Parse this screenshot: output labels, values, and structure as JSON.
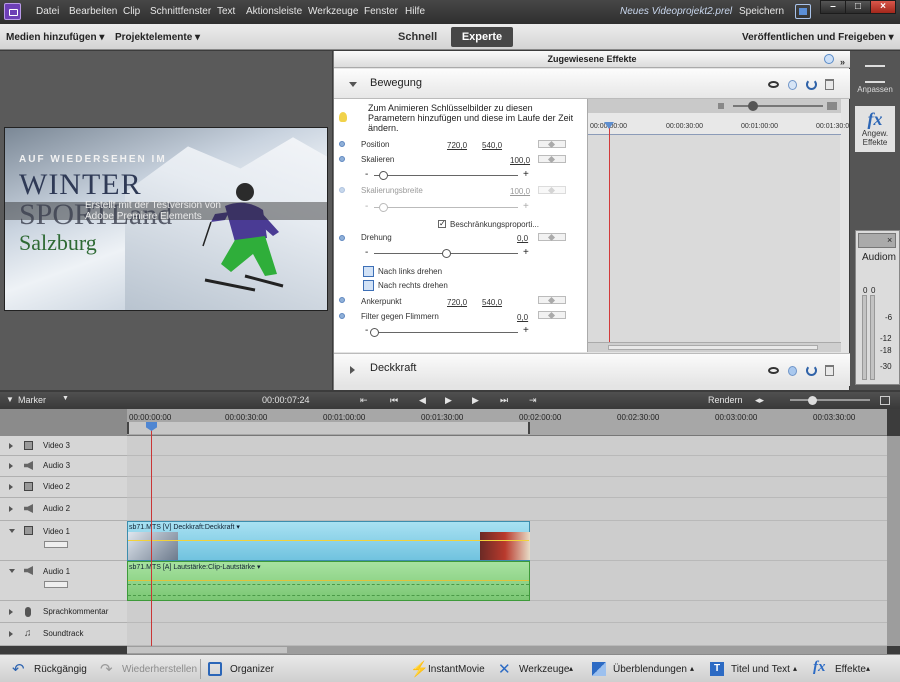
{
  "menubar": {
    "items": [
      "Datei",
      "Bearbeiten",
      "Clip",
      "Schnittfenster",
      "Text",
      "Aktionsleiste",
      "Werkzeuge",
      "Fenster",
      "Hilfe"
    ],
    "project_name": "Neues Videoprojekt2.prel",
    "save_label": "Speichern"
  },
  "window_controls": {
    "minimize": "–",
    "maximize": "□",
    "close": "×"
  },
  "modebar": {
    "add_media": "Medien hinzufügen",
    "project_elements": "Projektelemente",
    "tab_quick": "Schnell",
    "tab_expert": "Experte",
    "publish": "Veröffentlichen und Freigeben"
  },
  "monitor": {
    "overlay_heading": "AUF WIEDERSEHEN IM",
    "overlay_title": "WINTER",
    "overlay_title2": "SPORTLand",
    "overlay_city": "Salzburg",
    "watermark_line1": "Erstellt mit der Testversion von",
    "watermark_line2": "Adobe Premiere Elements"
  },
  "effects": {
    "panel_title": "Zugewiesene Effekte",
    "motion_title": "Bewegung",
    "opacity_title": "Deckkraft",
    "hint": "Zum Animieren Schlüsselbilder zu diesen Parametern hinzufügen und diese im Laufe der Zeit ändern.",
    "params": {
      "position_label": "Position",
      "position_x": "720,0",
      "position_y": "540,0",
      "scale_label": "Skalieren",
      "scale_value": "100,0",
      "scale_level": 0.06,
      "scale_width_label": "Skalierungsbreite",
      "scale_width_value": "100,0",
      "scale_width_level": 0.06,
      "constrain_label": "Beschränkungsproporti...",
      "rotation_label": "Drehung",
      "rotation_value": "0,0",
      "rotation_level": 0.5,
      "rotate_left": "Nach links drehen",
      "rotate_right": "Nach rechts drehen",
      "anchor_label": "Ankerpunkt",
      "anchor_x": "720,0",
      "anchor_y": "540,0",
      "flicker_label": "Filter gegen Flimmern",
      "flicker_value": "0,0",
      "flicker_level": 0.0,
      "minus": "-",
      "plus": "+"
    },
    "kf_ticks": [
      "00:00:00:00",
      "00:00:30:00",
      "00:01:00:00",
      "00:01:30:00"
    ]
  },
  "side_panel": {
    "adjust_label": "Anpassen",
    "effects_glyph": "fx",
    "effects_label1": "Angew.",
    "effects_label2": "Effekte",
    "audio_title": "Audiom",
    "meter_labels": [
      "0",
      "0",
      "-6",
      "-12",
      "-18",
      "-30"
    ]
  },
  "timeline": {
    "marker_label": "Marker",
    "timecode": "00:00:07:24",
    "render_label": "Rendern",
    "ticks": [
      "00:00:00:00",
      "00:00:30:00",
      "00:01:00:00",
      "00:01:30:00",
      "00:02:00:00",
      "00:02:30:00",
      "00:03:00:00",
      "00:03:30:00"
    ],
    "tracks": [
      "Video 3",
      "Audio 3",
      "Video 2",
      "Audio 2",
      "Video 1",
      "Audio 1",
      "Sprachkommentar",
      "Soundtrack"
    ],
    "video_clip_label": "sb71.MTS [V]  Deckkraft:Deckkraft ▾",
    "audio_clip_label": "sb71.MTS [A]  Lautstärke:Clip-Lautstärke ▾"
  },
  "actionbar": {
    "undo": "Rückgängig",
    "redo": "Wiederherstellen",
    "organizer": "Organizer",
    "instant_movie": "InstantMovie",
    "tools": "Werkzeuge",
    "transitions": "Überblendungen",
    "titles": "Titel und Text",
    "effects": "Effekte"
  },
  "colors": {
    "expert_tab": "#474747",
    "playhead": "#c93636",
    "video_clip": "#8fd3ea",
    "audio_clip": "#92d58b"
  }
}
